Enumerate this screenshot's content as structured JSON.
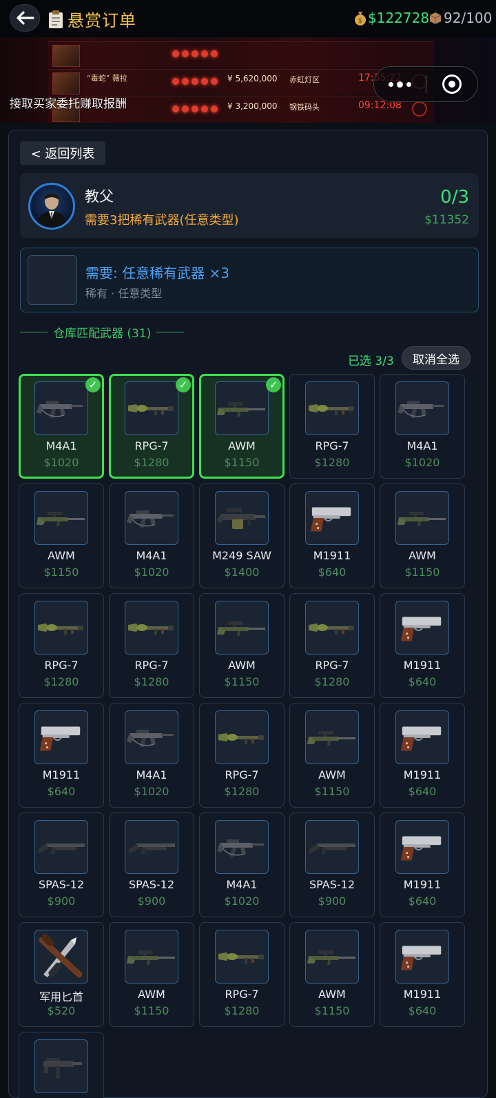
{
  "header": {
    "title": "悬赏订单",
    "money": "$122728",
    "capacity": "92/100"
  },
  "banner": {
    "tagline": "接取买家委托赚取报酬",
    "rows": [
      {
        "name": "“毒蛇” 薇拉",
        "amount": "¥ 5,620,000",
        "location": "赤虹灯区",
        "time": "17:35:22"
      },
      {
        "name": "",
        "amount": "¥ 3,200,000",
        "location": "钢铁码头",
        "time": "09:12:08"
      }
    ]
  },
  "panel": {
    "back_label": "< 返回列表",
    "client": {
      "name": "教父",
      "requirement": "需要3把稀有武器(任意类型)",
      "progress": "0/3",
      "reward": "$11352"
    },
    "need": {
      "title": "需要: 任意稀有武器 ×3",
      "subtitle": "稀有 · 任意类型"
    },
    "section_title": "仓库匹配武器 (31)",
    "selected_label": "已选 3/3",
    "deselect_label": "取消全选"
  },
  "weapons": [
    {
      "name": "M4A1",
      "price": "$1020",
      "icon": "rifle-icon",
      "selected": true
    },
    {
      "name": "RPG-7",
      "price": "$1280",
      "icon": "rocket-launcher-icon",
      "selected": true
    },
    {
      "name": "AWM",
      "price": "$1150",
      "icon": "sniper-icon",
      "selected": true
    },
    {
      "name": "RPG-7",
      "price": "$1280",
      "icon": "rocket-launcher-icon",
      "selected": false
    },
    {
      "name": "M4A1",
      "price": "$1020",
      "icon": "rifle-icon",
      "selected": false
    },
    {
      "name": "AWM",
      "price": "$1150",
      "icon": "sniper-icon",
      "selected": false
    },
    {
      "name": "M4A1",
      "price": "$1020",
      "icon": "rifle-icon",
      "selected": false
    },
    {
      "name": "M249 SAW",
      "price": "$1400",
      "icon": "machine-gun-icon",
      "selected": false
    },
    {
      "name": "M1911",
      "price": "$640",
      "icon": "pistol-icon",
      "selected": false
    },
    {
      "name": "AWM",
      "price": "$1150",
      "icon": "sniper-icon",
      "selected": false
    },
    {
      "name": "RPG-7",
      "price": "$1280",
      "icon": "rocket-launcher-icon",
      "selected": false
    },
    {
      "name": "RPG-7",
      "price": "$1280",
      "icon": "rocket-launcher-icon",
      "selected": false
    },
    {
      "name": "AWM",
      "price": "$1150",
      "icon": "sniper-icon",
      "selected": false
    },
    {
      "name": "RPG-7",
      "price": "$1280",
      "icon": "rocket-launcher-icon",
      "selected": false
    },
    {
      "name": "M1911",
      "price": "$640",
      "icon": "pistol-icon",
      "selected": false
    },
    {
      "name": "M1911",
      "price": "$640",
      "icon": "pistol-icon",
      "selected": false
    },
    {
      "name": "M4A1",
      "price": "$1020",
      "icon": "rifle-icon",
      "selected": false
    },
    {
      "name": "RPG-7",
      "price": "$1280",
      "icon": "rocket-launcher-icon",
      "selected": false
    },
    {
      "name": "AWM",
      "price": "$1150",
      "icon": "sniper-icon",
      "selected": false
    },
    {
      "name": "M1911",
      "price": "$640",
      "icon": "pistol-icon",
      "selected": false
    },
    {
      "name": "SPAS-12",
      "price": "$900",
      "icon": "shotgun-icon",
      "selected": false
    },
    {
      "name": "SPAS-12",
      "price": "$900",
      "icon": "shotgun-icon",
      "selected": false
    },
    {
      "name": "M4A1",
      "price": "$1020",
      "icon": "rifle-icon",
      "selected": false
    },
    {
      "name": "SPAS-12",
      "price": "$900",
      "icon": "shotgun-icon",
      "selected": false
    },
    {
      "name": "M1911",
      "price": "$640",
      "icon": "pistol-icon",
      "selected": false
    },
    {
      "name": "军用匕首",
      "price": "$520",
      "icon": "knife-icon",
      "selected": false
    },
    {
      "name": "AWM",
      "price": "$1150",
      "icon": "sniper-icon",
      "selected": false
    },
    {
      "name": "RPG-7",
      "price": "$1280",
      "icon": "rocket-launcher-icon",
      "selected": false
    },
    {
      "name": "AWM",
      "price": "$1150",
      "icon": "sniper-icon",
      "selected": false
    },
    {
      "name": "M1911",
      "price": "$640",
      "icon": "pistol-icon",
      "selected": false
    },
    {
      "name": "",
      "price": "",
      "icon": "smg-icon",
      "selected": false
    }
  ],
  "colors": {
    "accent_green": "#3fe07a",
    "title_gold": "#f2c14e",
    "requirement_orange": "#f2a93b",
    "need_blue": "#4aa3f5",
    "selected_border": "#3fe04f"
  }
}
